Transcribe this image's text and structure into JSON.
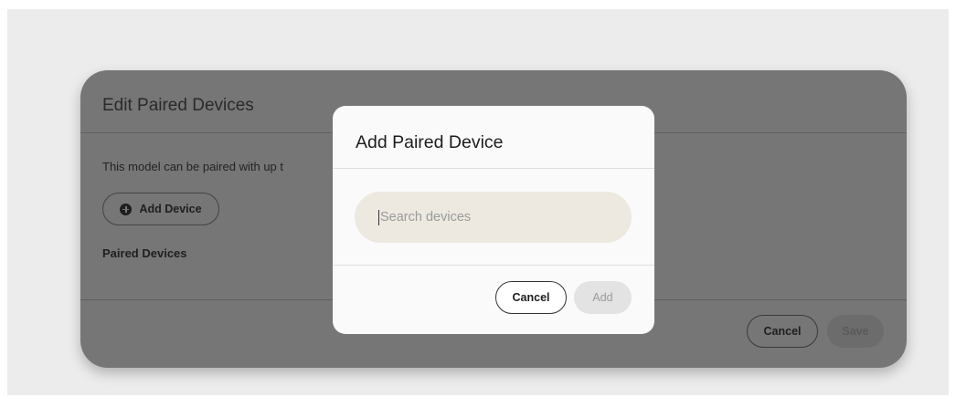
{
  "background_dialog": {
    "title": "Edit Paired Devices",
    "description": "This model can be paired with up t",
    "add_device_label": "Add Device",
    "paired_devices_label": "Paired Devices",
    "cancel_label": "Cancel",
    "save_label": "Save"
  },
  "modal": {
    "title": "Add Paired Device",
    "search_placeholder": "Search devices",
    "search_value": "",
    "cancel_label": "Cancel",
    "add_label": "Add"
  },
  "icons": {
    "add_device_icon": "plus-circle-icon"
  },
  "colors": {
    "overlay_dim": "#767676",
    "modal_surface": "#fafafa",
    "search_field_bg": "#ede9e1",
    "disabled_button_bg": "#e3e3e3"
  }
}
